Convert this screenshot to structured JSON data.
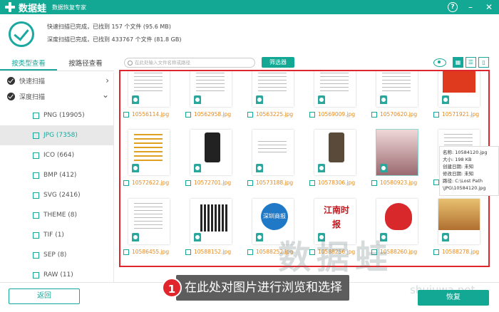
{
  "app": {
    "name": "数据蛙",
    "subtitle": "数据恢复专家"
  },
  "window_buttons": {
    "help": "?",
    "minimize": "–",
    "close": "✕"
  },
  "status": {
    "line1": "快速扫描已完成，已找到 157 个文件 (95.6 MB)",
    "line2": "深度扫描已完成，已找到 433767 个文件 (81.8 GB)"
  },
  "tabs": [
    {
      "label": "按类型查看"
    },
    {
      "label": "按路径查看"
    }
  ],
  "scans": [
    {
      "label": "快速扫描",
      "arrow": "›"
    },
    {
      "label": "深度扫描",
      "arrow": "⌄"
    }
  ],
  "types": [
    {
      "label": "PNG (19905)"
    },
    {
      "label": "JPG (7358)"
    },
    {
      "label": "ICO (664)"
    },
    {
      "label": "BMP (412)"
    },
    {
      "label": "SVG (2416)"
    },
    {
      "label": "THEME (8)"
    },
    {
      "label": "TIF (1)"
    },
    {
      "label": "SEP (8)"
    },
    {
      "label": "RAW (11)"
    }
  ],
  "toolbar": {
    "search_placeholder": "在此处输入文件名称或路径",
    "filter_label": "筛选器"
  },
  "files": [
    {
      "name": "10556114.jpg"
    },
    {
      "name": "10562958.jpg"
    },
    {
      "name": "10563225.jpg"
    },
    {
      "name": "10569009.jpg"
    },
    {
      "name": "10570620.jpg"
    },
    {
      "name": "10571921.jpg"
    },
    {
      "name": "10572622.jpg"
    },
    {
      "name": "10572701.jpg"
    },
    {
      "name": "10573188.jpg"
    },
    {
      "name": "10578306.jpg"
    },
    {
      "name": "10580923.jpg"
    },
    {
      "name": ""
    },
    {
      "name": "10586455.jpg"
    },
    {
      "name": "10588152.jpg"
    },
    {
      "name": "10588252.jpg"
    },
    {
      "name": "10588256.jpg"
    },
    {
      "name": "10588260.jpg"
    },
    {
      "name": "10588278.jpg"
    }
  ],
  "thumb_text": {
    "shenzhen": "深圳商报",
    "jiangnan": "江南时报"
  },
  "tooltip": {
    "name": "名称:  10584120.jpg",
    "size": "大小:  198 KB",
    "created": "创建日期: 未知",
    "modified": "修改日期: 未知",
    "path": "路径:  C:\\Lost Path",
    "path2": "\\JPG\\10584120.jpg"
  },
  "watermark": {
    "text": "数据蛙",
    "url": "shujuwa.net"
  },
  "buttons": {
    "back": "返回",
    "recover": "恢复"
  },
  "callout": {
    "number": "1",
    "text": "在此处对图片进行浏览和选择"
  },
  "colors": {
    "brand": "#13a894",
    "highlight": "#e0262c",
    "filename": "#e58a1e"
  }
}
